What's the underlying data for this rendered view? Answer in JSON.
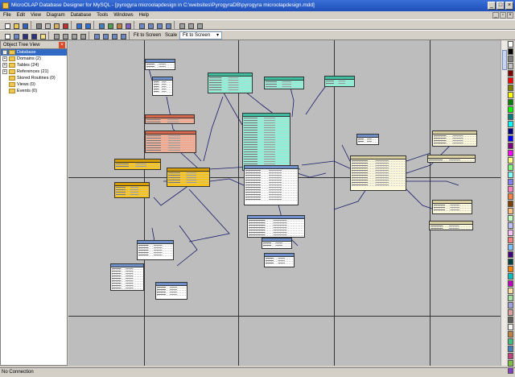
{
  "window": {
    "title": "MicroOLAP Database Designer for MySQL - [pyrogyra microolapdesign in C:\\websites\\PyrogyraDB\\pyrogyra microolapdesign.mdd]"
  },
  "menu": [
    "File",
    "Edit",
    "View",
    "Diagram",
    "Database",
    "Tools",
    "Windows",
    "Help"
  ],
  "toolbar": {
    "fit_label": "Fit to Screen",
    "scale_label": "Scale",
    "scale_value": "Fit to Screen"
  },
  "object_tree": {
    "title": "Object Tree View",
    "items": [
      {
        "label": "Database",
        "expander": "-",
        "selected": true
      },
      {
        "label": "Domains (2)",
        "expander": "+"
      },
      {
        "label": "Tables (24)",
        "expander": "+"
      },
      {
        "label": "References (21)",
        "expander": "+"
      },
      {
        "label": "Stored Routines (0)",
        "expander": ""
      },
      {
        "label": "Views (0)",
        "expander": ""
      },
      {
        "label": "Events (0)",
        "expander": ""
      }
    ]
  },
  "status": {
    "text": "No Connection"
  },
  "palette_colors": [
    "#ffffff",
    "#000000",
    "#808080",
    "#c0c0c0",
    "#800000",
    "#ff0000",
    "#808000",
    "#ffff00",
    "#008000",
    "#00ff00",
    "#008080",
    "#00ffff",
    "#000080",
    "#0000ff",
    "#800080",
    "#ff00ff",
    "#ffff80",
    "#80ff80",
    "#80ffff",
    "#8080ff",
    "#ff80c0",
    "#ff8040",
    "#804000",
    "#ffc080",
    "#c0ffc0",
    "#c0c0ff",
    "#ffc0ff",
    "#ff8080",
    "#80c0ff",
    "#400080",
    "#004040",
    "#ff8000",
    "#00c0c0",
    "#c000c0",
    "#ffe0a0",
    "#a0e0a0",
    "#a0a0e0",
    "#e0a0a0",
    "#606060",
    "#f0f0f0",
    "#c08040",
    "#40c080",
    "#4080c0",
    "#c04080",
    "#80c040",
    "#8040c0"
  ]
}
